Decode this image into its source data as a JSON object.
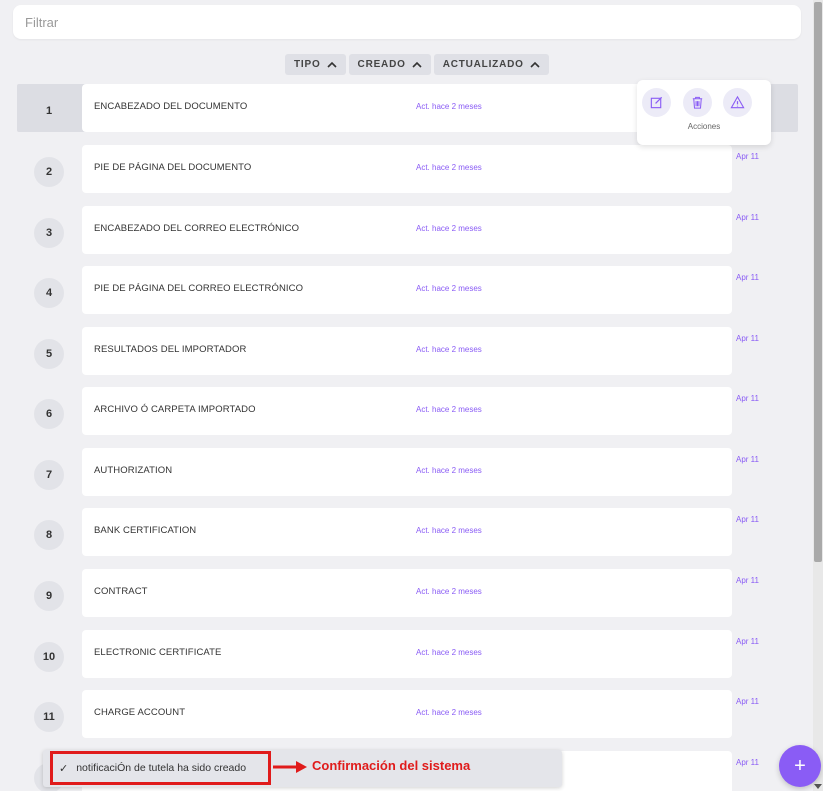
{
  "filter": {
    "placeholder": "Filtrar",
    "value": ""
  },
  "sort": [
    {
      "label": "TIPO"
    },
    {
      "label": "CREADO"
    },
    {
      "label": "ACTUALIZADO"
    }
  ],
  "rows": [
    {
      "number": "1",
      "name": "ENCABEZADO DEL DOCUMENTO",
      "updated": "Act. hace 2 meses",
      "date": ""
    },
    {
      "number": "2",
      "name": "PIE DE PÁGINA DEL DOCUMENTO",
      "updated": "Act. hace 2 meses",
      "date": "Apr 11"
    },
    {
      "number": "3",
      "name": "ENCABEZADO DEL CORREO ELECTRÓNICO",
      "updated": "Act. hace 2 meses",
      "date": "Apr 11"
    },
    {
      "number": "4",
      "name": "PIE DE PÁGINA DEL CORREO ELECTRÓNICO",
      "updated": "Act. hace 2 meses",
      "date": "Apr 11"
    },
    {
      "number": "5",
      "name": "RESULTADOS DEL IMPORTADOR",
      "updated": "Act. hace 2 meses",
      "date": "Apr 11"
    },
    {
      "number": "6",
      "name": "ARCHIVO Ó CARPETA IMPORTADO",
      "updated": "Act. hace 2 meses",
      "date": "Apr 11"
    },
    {
      "number": "7",
      "name": "AUTHORIZATION",
      "updated": "Act. hace 2 meses",
      "date": "Apr 11"
    },
    {
      "number": "8",
      "name": "BANK CERTIFICATION",
      "updated": "Act. hace 2 meses",
      "date": "Apr 11"
    },
    {
      "number": "9",
      "name": "CONTRACT",
      "updated": "Act. hace 2 meses",
      "date": "Apr 11"
    },
    {
      "number": "10",
      "name": "ELECTRONIC CERTIFICATE",
      "updated": "Act. hace 2 meses",
      "date": "Apr 11"
    },
    {
      "number": "11",
      "name": "CHARGE ACCOUNT",
      "updated": "Act. hace 2 meses",
      "date": "Apr 11"
    },
    {
      "number": "12",
      "name": "",
      "updated": "",
      "date": "Apr 11"
    }
  ],
  "actions": {
    "label": "Acciones",
    "buttons": [
      {
        "icon": "edit-icon"
      },
      {
        "icon": "trash-icon"
      },
      {
        "icon": "warning-icon"
      }
    ]
  },
  "toast": {
    "message": "notificaciÓn de tutela ha sido creado",
    "check_icon": "check-icon"
  },
  "annotation": {
    "text": "Confirmación del sistema"
  },
  "fab": {
    "icon": "plus-icon",
    "label": "+"
  },
  "colors": {
    "accent": "#8a5cf5",
    "annotation": "#e01b1b",
    "background": "#f0f0f3"
  }
}
